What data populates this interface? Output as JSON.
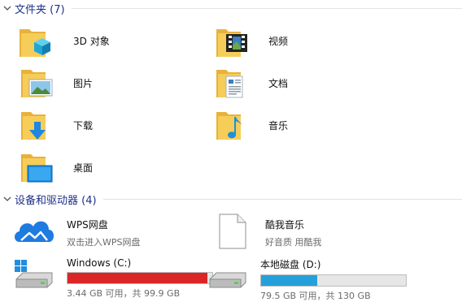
{
  "folders_section": {
    "title": "文件夹 (7)",
    "items": [
      {
        "label": "3D 对象"
      },
      {
        "label": "视频"
      },
      {
        "label": "图片"
      },
      {
        "label": "文档"
      },
      {
        "label": "下载"
      },
      {
        "label": "音乐"
      },
      {
        "label": "桌面"
      }
    ]
  },
  "devices_section": {
    "title": "设备和驱动器 (4)",
    "items": [
      {
        "name": "WPS网盘",
        "sub": "双击进入WPS网盘"
      },
      {
        "name": "酷我音乐",
        "sub": "好音质 用酷我"
      },
      {
        "name": "Windows (C:)",
        "sub": "3.44 GB 可用，共 99.9 GB",
        "used_fraction": 0.966,
        "bar_color": "#da2626"
      },
      {
        "name": "本地磁盘 (D:)",
        "sub": "79.5 GB 可用，共 130 GB",
        "used_fraction": 0.388,
        "bar_color": "#26a0da"
      }
    ]
  },
  "colors": {
    "section_title": "#1e3287",
    "folder_yellow": "#f5c94a",
    "cloud_blue": "#1e7be0"
  }
}
